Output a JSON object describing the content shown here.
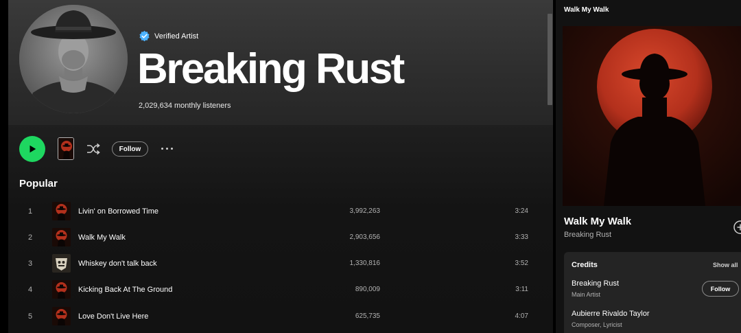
{
  "artist": {
    "verified_label": "Verified Artist",
    "name": "Breaking Rust",
    "monthly_listeners": "2,029,634 monthly listeners"
  },
  "actions": {
    "follow_label": "Follow",
    "play_icon": "play-icon",
    "shuffle_icon": "shuffle-icon",
    "more_icon": "more-options-icon"
  },
  "popular": {
    "title": "Popular",
    "tracks": [
      {
        "number": "1",
        "title": "Livin' on Borrowed Time",
        "plays": "3,992,263",
        "duration": "3:24",
        "art": "red-moon-cowboy"
      },
      {
        "number": "2",
        "title": "Walk My Walk",
        "plays": "2,903,656",
        "duration": "3:33",
        "art": "red-moon-cowboy"
      },
      {
        "number": "3",
        "title": "Whiskey don't talk back",
        "plays": "1,330,816",
        "duration": "3:52",
        "art": "skull-badge"
      },
      {
        "number": "4",
        "title": "Kicking Back At The Ground",
        "plays": "890,009",
        "duration": "3:11",
        "art": "red-moon-cowboy"
      },
      {
        "number": "5",
        "title": "Love Don't Live Here",
        "plays": "625,735",
        "duration": "4:07",
        "art": "red-moon-cowboy"
      }
    ]
  },
  "now_playing": {
    "header": "Walk My Walk",
    "title": "Walk My Walk",
    "artist": "Breaking Rust",
    "credits": {
      "title": "Credits",
      "show_all": "Show all",
      "entries": [
        {
          "name": "Breaking Rust",
          "role": "Main Artist",
          "follow_label": "Follow"
        },
        {
          "name": "Aubierre Rivaldo Taylor",
          "role": "Composer, Lyricist"
        }
      ]
    }
  },
  "colors": {
    "accent_green": "#1ed760",
    "verified_blue": "#4cb3ff",
    "moon_red": "#c0341e",
    "background": "#121212"
  }
}
